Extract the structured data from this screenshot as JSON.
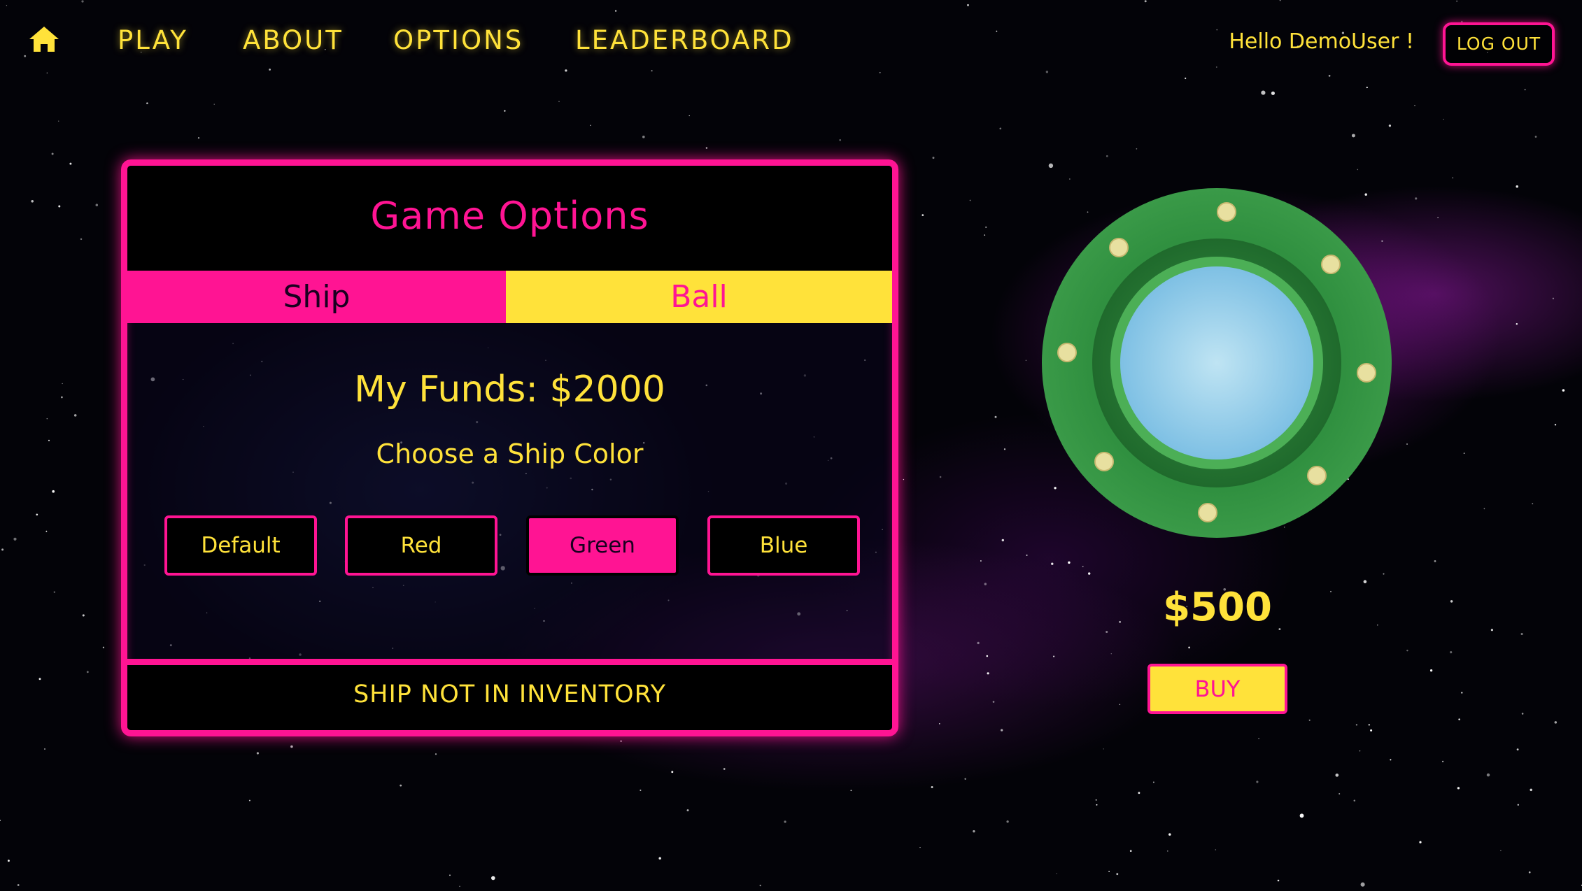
{
  "nav": {
    "home_icon": "home-icon",
    "links": [
      "PLAY",
      "ABOUT",
      "OPTIONS",
      "LEADERBOARD"
    ],
    "greeting": "Hello DemoUser !",
    "logout_label": "LOG OUT"
  },
  "panel": {
    "title": "Game Options",
    "tabs": [
      {
        "label": "Ship",
        "active": true
      },
      {
        "label": "Ball",
        "active": false
      }
    ],
    "funds": "My Funds: $2000",
    "prompt": "Choose a Ship Color",
    "colors": [
      {
        "label": "Default",
        "selected": false
      },
      {
        "label": "Red",
        "selected": false
      },
      {
        "label": "Green",
        "selected": true
      },
      {
        "label": "Blue",
        "selected": false
      }
    ],
    "inventory_status": "SHIP NOT IN INVENTORY"
  },
  "preview": {
    "ship_color": "green",
    "price": "$500",
    "buy_label": "BUY"
  },
  "colors": {
    "accent_pink": "#ff1493",
    "accent_yellow": "#ffe23a",
    "ship_hull": "#2e8b3e",
    "ship_dome": "#87c7e8"
  }
}
